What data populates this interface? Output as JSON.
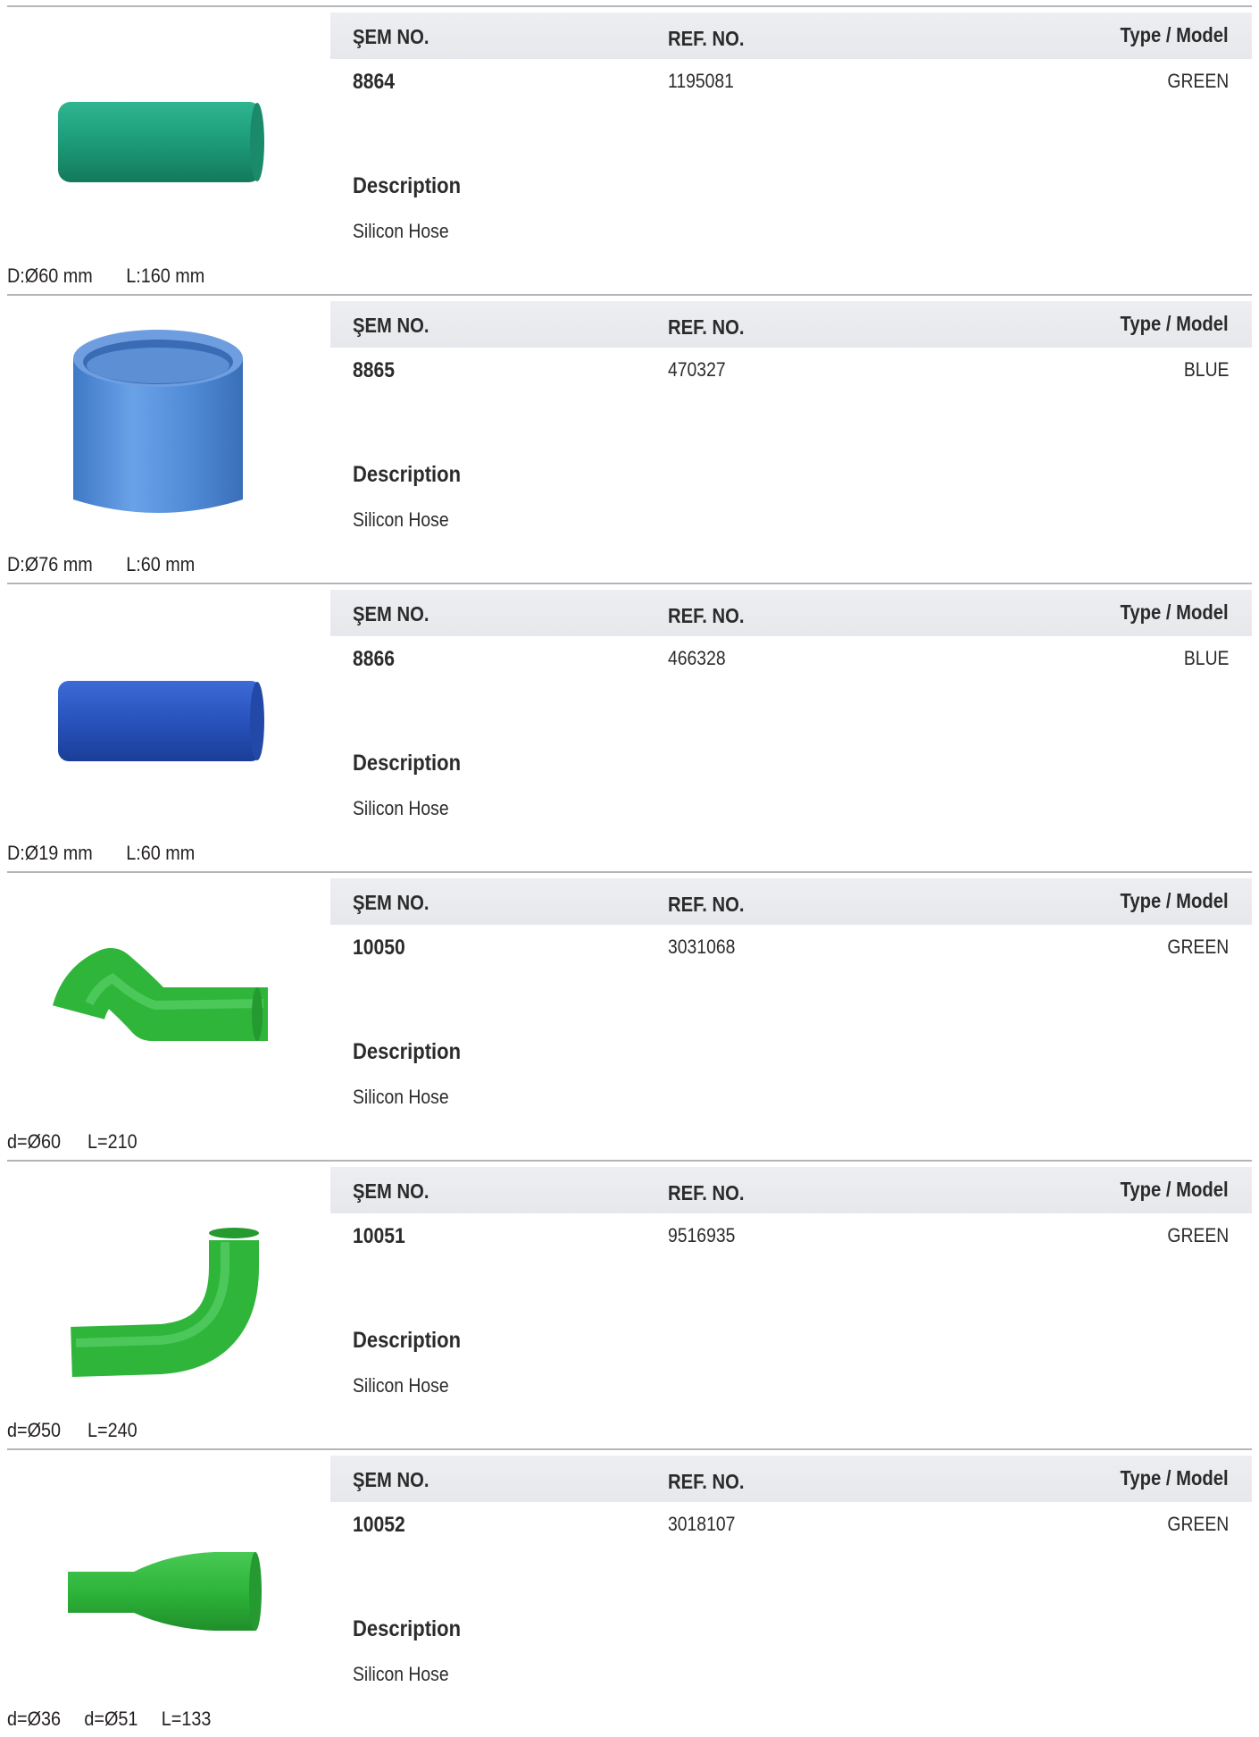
{
  "labels": {
    "sem_no": "ŞEM NO.",
    "ref_no": "REF. NO.",
    "type_model": "Type / Model",
    "description": "Description"
  },
  "products": [
    {
      "sem_no": "8864",
      "ref_no": "1195081",
      "type_model": "GREEN",
      "description": "Silicon Hose",
      "dims": [
        "D:Ø60 mm",
        "L:160 mm"
      ],
      "image": "straight-hose-teal",
      "color": "#1e9e7a"
    },
    {
      "sem_no": "8865",
      "ref_no": "470327",
      "type_model": "BLUE",
      "description": "Silicon Hose",
      "dims": [
        "D:Ø76 mm",
        "L:60 mm"
      ],
      "image": "short-wide-hose-blue",
      "color": "#4f8ad6"
    },
    {
      "sem_no": "8866",
      "ref_no": "466328",
      "type_model": "BLUE",
      "description": "Silicon Hose",
      "dims": [
        "D:Ø19 mm",
        "L:60 mm"
      ],
      "image": "straight-hose-blue",
      "color": "#2a55c0"
    },
    {
      "sem_no": "10050",
      "ref_no": "3031068",
      "type_model": "GREEN",
      "description": "Silicon Hose",
      "dims": [
        "d=Ø60",
        "L=210"
      ],
      "image": "elbow-45-hose-green",
      "color": "#2eb53a"
    },
    {
      "sem_no": "10051",
      "ref_no": "9516935",
      "type_model": "GREEN",
      "description": "Silicon Hose",
      "dims": [
        "d=Ø50",
        "L=240"
      ],
      "image": "elbow-90-hose-green",
      "color": "#2eb53a"
    },
    {
      "sem_no": "10052",
      "ref_no": "3018107",
      "type_model": "GREEN",
      "description": "Silicon Hose",
      "dims": [
        "d=Ø36",
        "d=Ø51",
        "L=133"
      ],
      "image": "reducer-hose-green",
      "color": "#2eb53a"
    }
  ]
}
